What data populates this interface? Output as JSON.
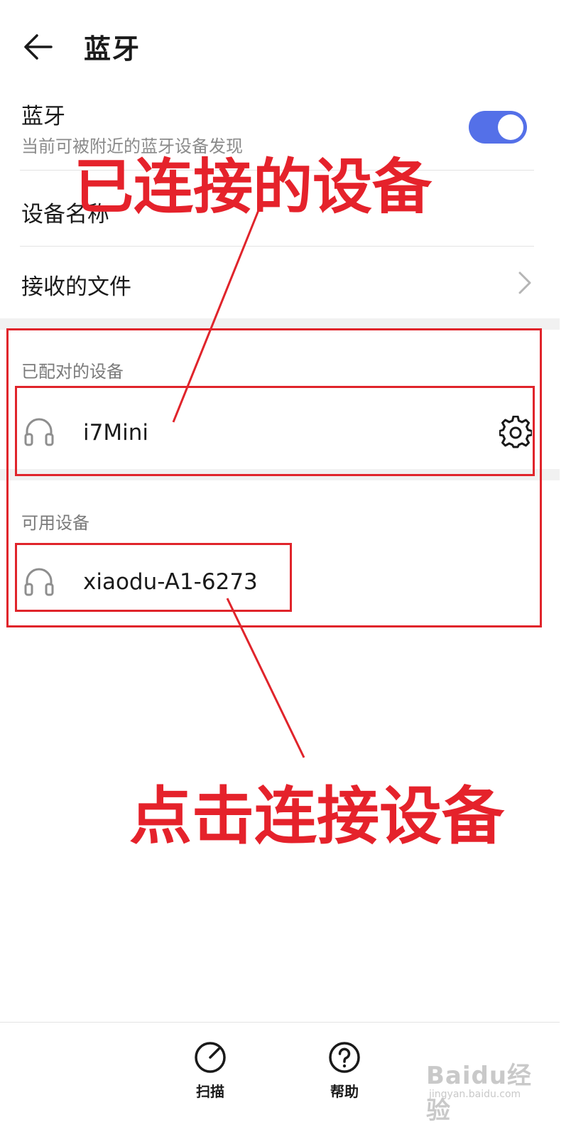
{
  "header": {
    "back_icon": "arrow-left-icon",
    "title": "蓝牙"
  },
  "bluetooth": {
    "label": "蓝牙",
    "description": "当前可被附近的蓝牙设备发现",
    "enabled": true,
    "toggle_color": "#5470e8"
  },
  "settings_rows": {
    "device_name": "设备名称",
    "received_files": "接收的文件"
  },
  "paired_section": {
    "title": "已配对的设备",
    "devices": [
      {
        "name": "i7Mini",
        "icon": "headset-icon",
        "action_icon": "gear-icon"
      }
    ]
  },
  "available_section": {
    "title": "可用设备",
    "devices": [
      {
        "name": "xiaodu-A1-6273",
        "icon": "headset-icon"
      }
    ]
  },
  "annotations": {
    "connected_label": "已连接的设备",
    "tap_label": "点击连接设备",
    "color": "#e0242b"
  },
  "bottom_bar": {
    "scan_label": "扫描",
    "help_label": "帮助"
  },
  "watermark": {
    "main": "Baidu经验",
    "sub": "jingyan.baidu.com"
  }
}
